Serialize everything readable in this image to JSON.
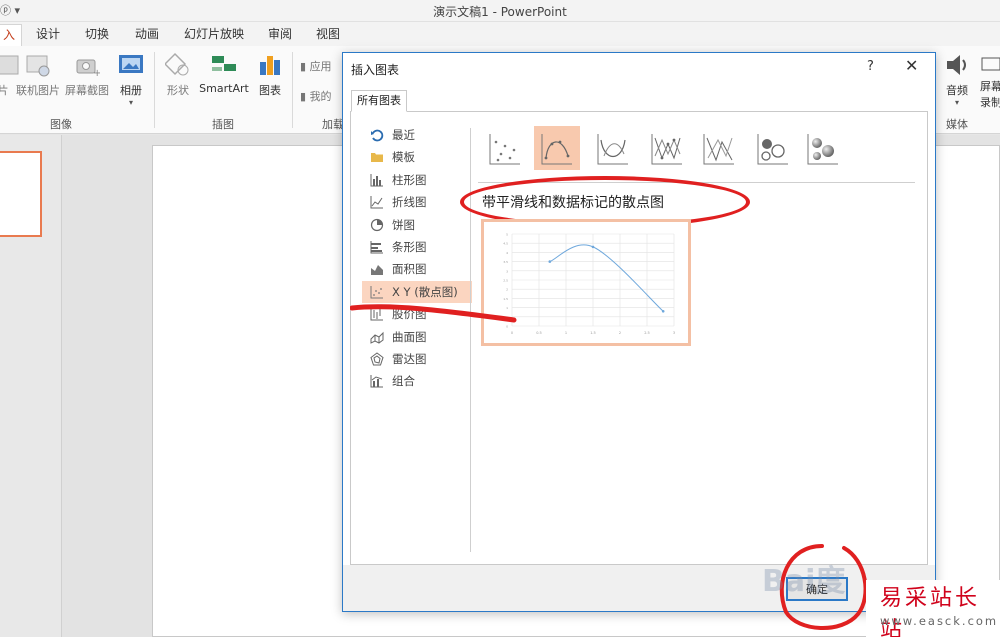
{
  "window": {
    "title": "演示文稿1 - PowerPoint",
    "qat_glyph": "ⓟ ▾"
  },
  "tabs": [
    {
      "label": "入",
      "active": true
    },
    {
      "label": "设计"
    },
    {
      "label": "切换"
    },
    {
      "label": "动画"
    },
    {
      "label": "幻灯片放映"
    },
    {
      "label": "审阅"
    },
    {
      "label": "视图"
    }
  ],
  "ribbon": {
    "images": {
      "pictures_partial": "片",
      "online": "联机图片",
      "screenshot": "屏幕截图",
      "album": "相册",
      "label": "图像"
    },
    "illustrations": {
      "shapes": "形状",
      "smartart": "SmartArt",
      "chart": "图表",
      "label": "插图"
    },
    "addins": {
      "store": "应用",
      "my": "我的",
      "label": "加载"
    },
    "media": {
      "audio": "音频",
      "record_partial_1": "屏幕",
      "record_partial_2": "录制",
      "label": "媒体"
    }
  },
  "dialog": {
    "title": "插入图表",
    "help": "?",
    "close": "✕",
    "tab": "所有图表",
    "categories": [
      {
        "label": "最近",
        "icon": "recent-icon"
      },
      {
        "label": "模板",
        "icon": "folder-icon"
      },
      {
        "label": "柱形图",
        "icon": "column-chart-icon"
      },
      {
        "label": "折线图",
        "icon": "line-chart-icon"
      },
      {
        "label": "饼图",
        "icon": "pie-chart-icon"
      },
      {
        "label": "条形图",
        "icon": "bar-chart-icon"
      },
      {
        "label": "面积图",
        "icon": "area-chart-icon"
      },
      {
        "label": "X Y (散点图)",
        "icon": "scatter-chart-icon",
        "selected": true
      },
      {
        "label": "股价图",
        "icon": "stock-chart-icon"
      },
      {
        "label": "曲面图",
        "icon": "surface-chart-icon"
      },
      {
        "label": "雷达图",
        "icon": "radar-chart-icon"
      },
      {
        "label": "组合",
        "icon": "combo-chart-icon"
      }
    ],
    "subtypes": [
      {
        "icon": "scatter-markers-icon"
      },
      {
        "icon": "scatter-smooth-lines-markers-icon",
        "selected": true
      },
      {
        "icon": "scatter-smooth-lines-icon"
      },
      {
        "icon": "scatter-straight-lines-markers-icon"
      },
      {
        "icon": "scatter-straight-lines-icon"
      },
      {
        "icon": "bubble-icon"
      },
      {
        "icon": "3d-bubble-icon"
      }
    ],
    "selected_subtype_name": "带平滑线和数据标记的散点图",
    "ok_label": "确定",
    "annotation_color": "#e02020",
    "selection_color": "#f8c9ae"
  },
  "watermarks": {
    "baidu": "Bai度",
    "site_name": "易采站长站",
    "site_url": "www.easck.com"
  },
  "chart_data": {
    "type": "scatter",
    "smooth": true,
    "markers": true,
    "x": [
      0.7,
      1.5,
      2.8
    ],
    "y": [
      3.5,
      4.3,
      0.8
    ],
    "xlim": [
      0,
      3
    ],
    "ylim": [
      0,
      5
    ],
    "x_ticks": [
      "0",
      "0.5",
      "1",
      "1.5",
      "2",
      "2.5",
      "3"
    ],
    "grid": true,
    "line_color": "#6fa8dc"
  }
}
